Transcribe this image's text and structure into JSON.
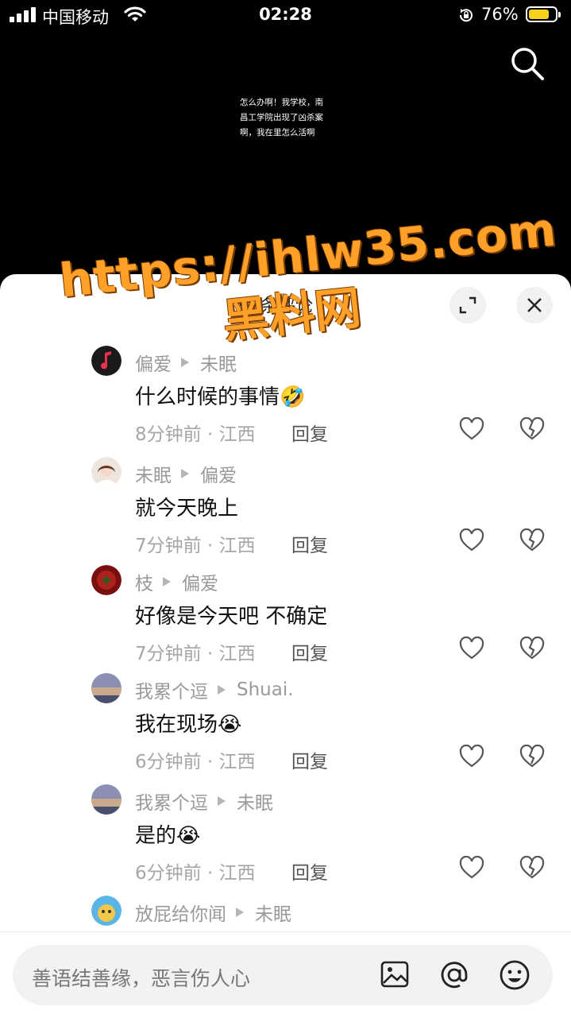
{
  "status_bar": {
    "carrier": "中国移动",
    "time": "02:28",
    "battery": "76%"
  },
  "video": {
    "caption": "怎么办啊！我学校，南昌工学院出现了凶杀案啊，我在里怎么活啊"
  },
  "watermark": {
    "line1": "https://ihlw35.com",
    "line2": "黑料网"
  },
  "sheet": {
    "title": "98条评论"
  },
  "comments": [
    {
      "user": "偏爱",
      "reply_to": "未眠",
      "text": "什么时候的事情🤣",
      "meta": "8分钟前 · 江西",
      "reply_label": "回复"
    },
    {
      "user": "未眠",
      "reply_to": "偏爱",
      "text": "就今天晚上",
      "meta": "7分钟前 · 江西",
      "reply_label": "回复"
    },
    {
      "user": "枝",
      "reply_to": "偏爱",
      "text": "好像是今天吧  不确定",
      "meta": "7分钟前 · 江西",
      "reply_label": "回复"
    },
    {
      "user": "我累个逗",
      "reply_to": "Shuai.",
      "text": "我在现场😭",
      "meta": "6分钟前 · 江西",
      "reply_label": "回复"
    },
    {
      "user": "我累个逗",
      "reply_to": "未眠",
      "text": "是的😭",
      "meta": "6分钟前 · 江西",
      "reply_label": "回复"
    },
    {
      "user": "放屁给你闻",
      "reply_to": "未眠"
    }
  ],
  "input": {
    "placeholder": "善语结善缘，恶言伤人心"
  },
  "colors": {
    "accent_watermark": "#ffa128",
    "battery": "#f7d21a"
  }
}
